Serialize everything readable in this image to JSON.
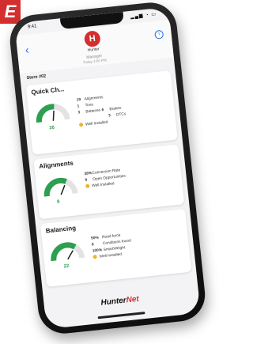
{
  "corner_badge": "E",
  "status": {
    "time": "9:41",
    "icons": "▂▄▆ ◔ ▭"
  },
  "header": {
    "back": "‹",
    "info": "i",
    "logo_letter": "H",
    "brand": "Hunter",
    "subtitle": "Manager",
    "date": "Today 1:00 PM"
  },
  "store_label": "Store #02",
  "cards": [
    {
      "title": "Quick Ch...",
      "gauge_value": "26",
      "gauge_fraction": 0.55,
      "rows": [
        {
          "num": "19",
          "label": "Alignments"
        },
        {
          "num": "1",
          "label": "Tires"
        },
        {
          "num": "3",
          "label": "Batteries",
          "num2": "6",
          "label2": "Brakes"
        },
        {
          "num2": "3",
          "label2": "DTCs"
        }
      ],
      "status": "Well Installed"
    },
    {
      "title": "Alignments",
      "gauge_value": "8",
      "gauge_fraction": 0.65,
      "rows": [
        {
          "num": "38%",
          "label": "Conversion Rate"
        },
        {
          "num": "9",
          "label": "Open Opportunities"
        }
      ],
      "status": "Well Installed"
    },
    {
      "title": "Balancing",
      "gauge_value": "22",
      "gauge_fraction": 0.7,
      "rows": [
        {
          "num": "50%",
          "label": "Road force"
        },
        {
          "num": "8",
          "label": "Conditions found"
        },
        {
          "num": "100%",
          "label": "SmartWeight"
        }
      ],
      "status": "Well Installed"
    }
  ],
  "footer_brand": {
    "hunter": "Hunter",
    "net": "Net"
  },
  "colors": {
    "accent": "#d32f2f",
    "gauge_green": "#2e9e50",
    "link_blue": "#1e73e8",
    "status_dot": "#f0b429"
  }
}
